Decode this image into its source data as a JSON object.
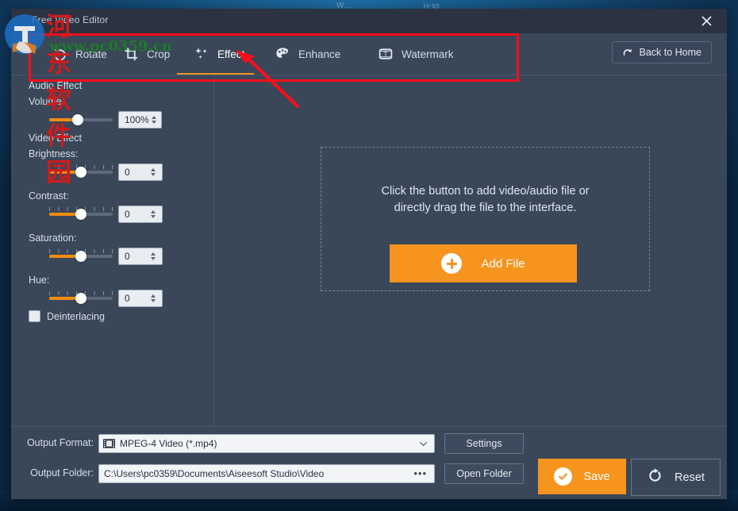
{
  "desktop": {
    "text_fragments": [
      "W...",
      "比较"
    ]
  },
  "window": {
    "title": "Free Video Editor",
    "close_icon": "close-icon"
  },
  "toolbar": {
    "tabs": [
      {
        "label": "Rotate",
        "icon": "rotate-icon",
        "active": false
      },
      {
        "label": "Crop",
        "icon": "crop-icon",
        "active": false
      },
      {
        "label": "Effect",
        "icon": "effect-stars-icon",
        "active": true
      },
      {
        "label": "Enhance",
        "icon": "palette-icon",
        "active": false
      },
      {
        "label": "Watermark",
        "icon": "watermark-text-icon",
        "active": false
      }
    ],
    "back_home_label": "Back to Home",
    "back_home_icon": "redo-arrow-icon",
    "active_tab": "Effect"
  },
  "effects_panel": {
    "audio_group_title": "Audio Effect",
    "video_group_title": "Video Effect",
    "controls": [
      {
        "label": "Volume:",
        "value": "100%",
        "slider_percent": 45
      },
      {
        "label": "Brightness:",
        "value": "0",
        "slider_percent": 50
      },
      {
        "label": "Contrast:",
        "value": "0",
        "slider_percent": 50
      },
      {
        "label": "Saturation:",
        "value": "0",
        "slider_percent": 50
      },
      {
        "label": "Hue:",
        "value": "0",
        "slider_percent": 50
      }
    ],
    "deinterlacing_label": "Deinterlacing",
    "deinterlacing_checked": false
  },
  "dropzone": {
    "line1": "Click the button to add video/audio file or",
    "line2": "directly drag the file to the interface.",
    "add_file_label": "Add File",
    "add_file_icon": "plus-circle-icon"
  },
  "output": {
    "format_label": "Output Format:",
    "format_value": "MPEG-4 Video (*.mp4)",
    "format_icon": "film-strip-icon",
    "settings_label": "Settings",
    "folder_label": "Output Folder:",
    "folder_value": "C:\\Users\\pc0359\\Documents\\Aiseesoft Studio\\Video",
    "browse_icon": "ellipsis-icon",
    "open_folder_label": "Open Folder"
  },
  "actions": {
    "save_label": "Save",
    "save_icon": "check-circle-icon",
    "reset_label": "Reset",
    "reset_icon": "refresh-icon"
  },
  "watermark": {
    "site_name": "河东软件园",
    "url": "www.pc0359.cn"
  },
  "colors": {
    "accent_orange": "#f7941d",
    "panel_bg": "#394758",
    "titlebar_bg": "#2b3241",
    "annotation_red": "#fc0d1b",
    "field_bg": "#f2f4f7"
  }
}
